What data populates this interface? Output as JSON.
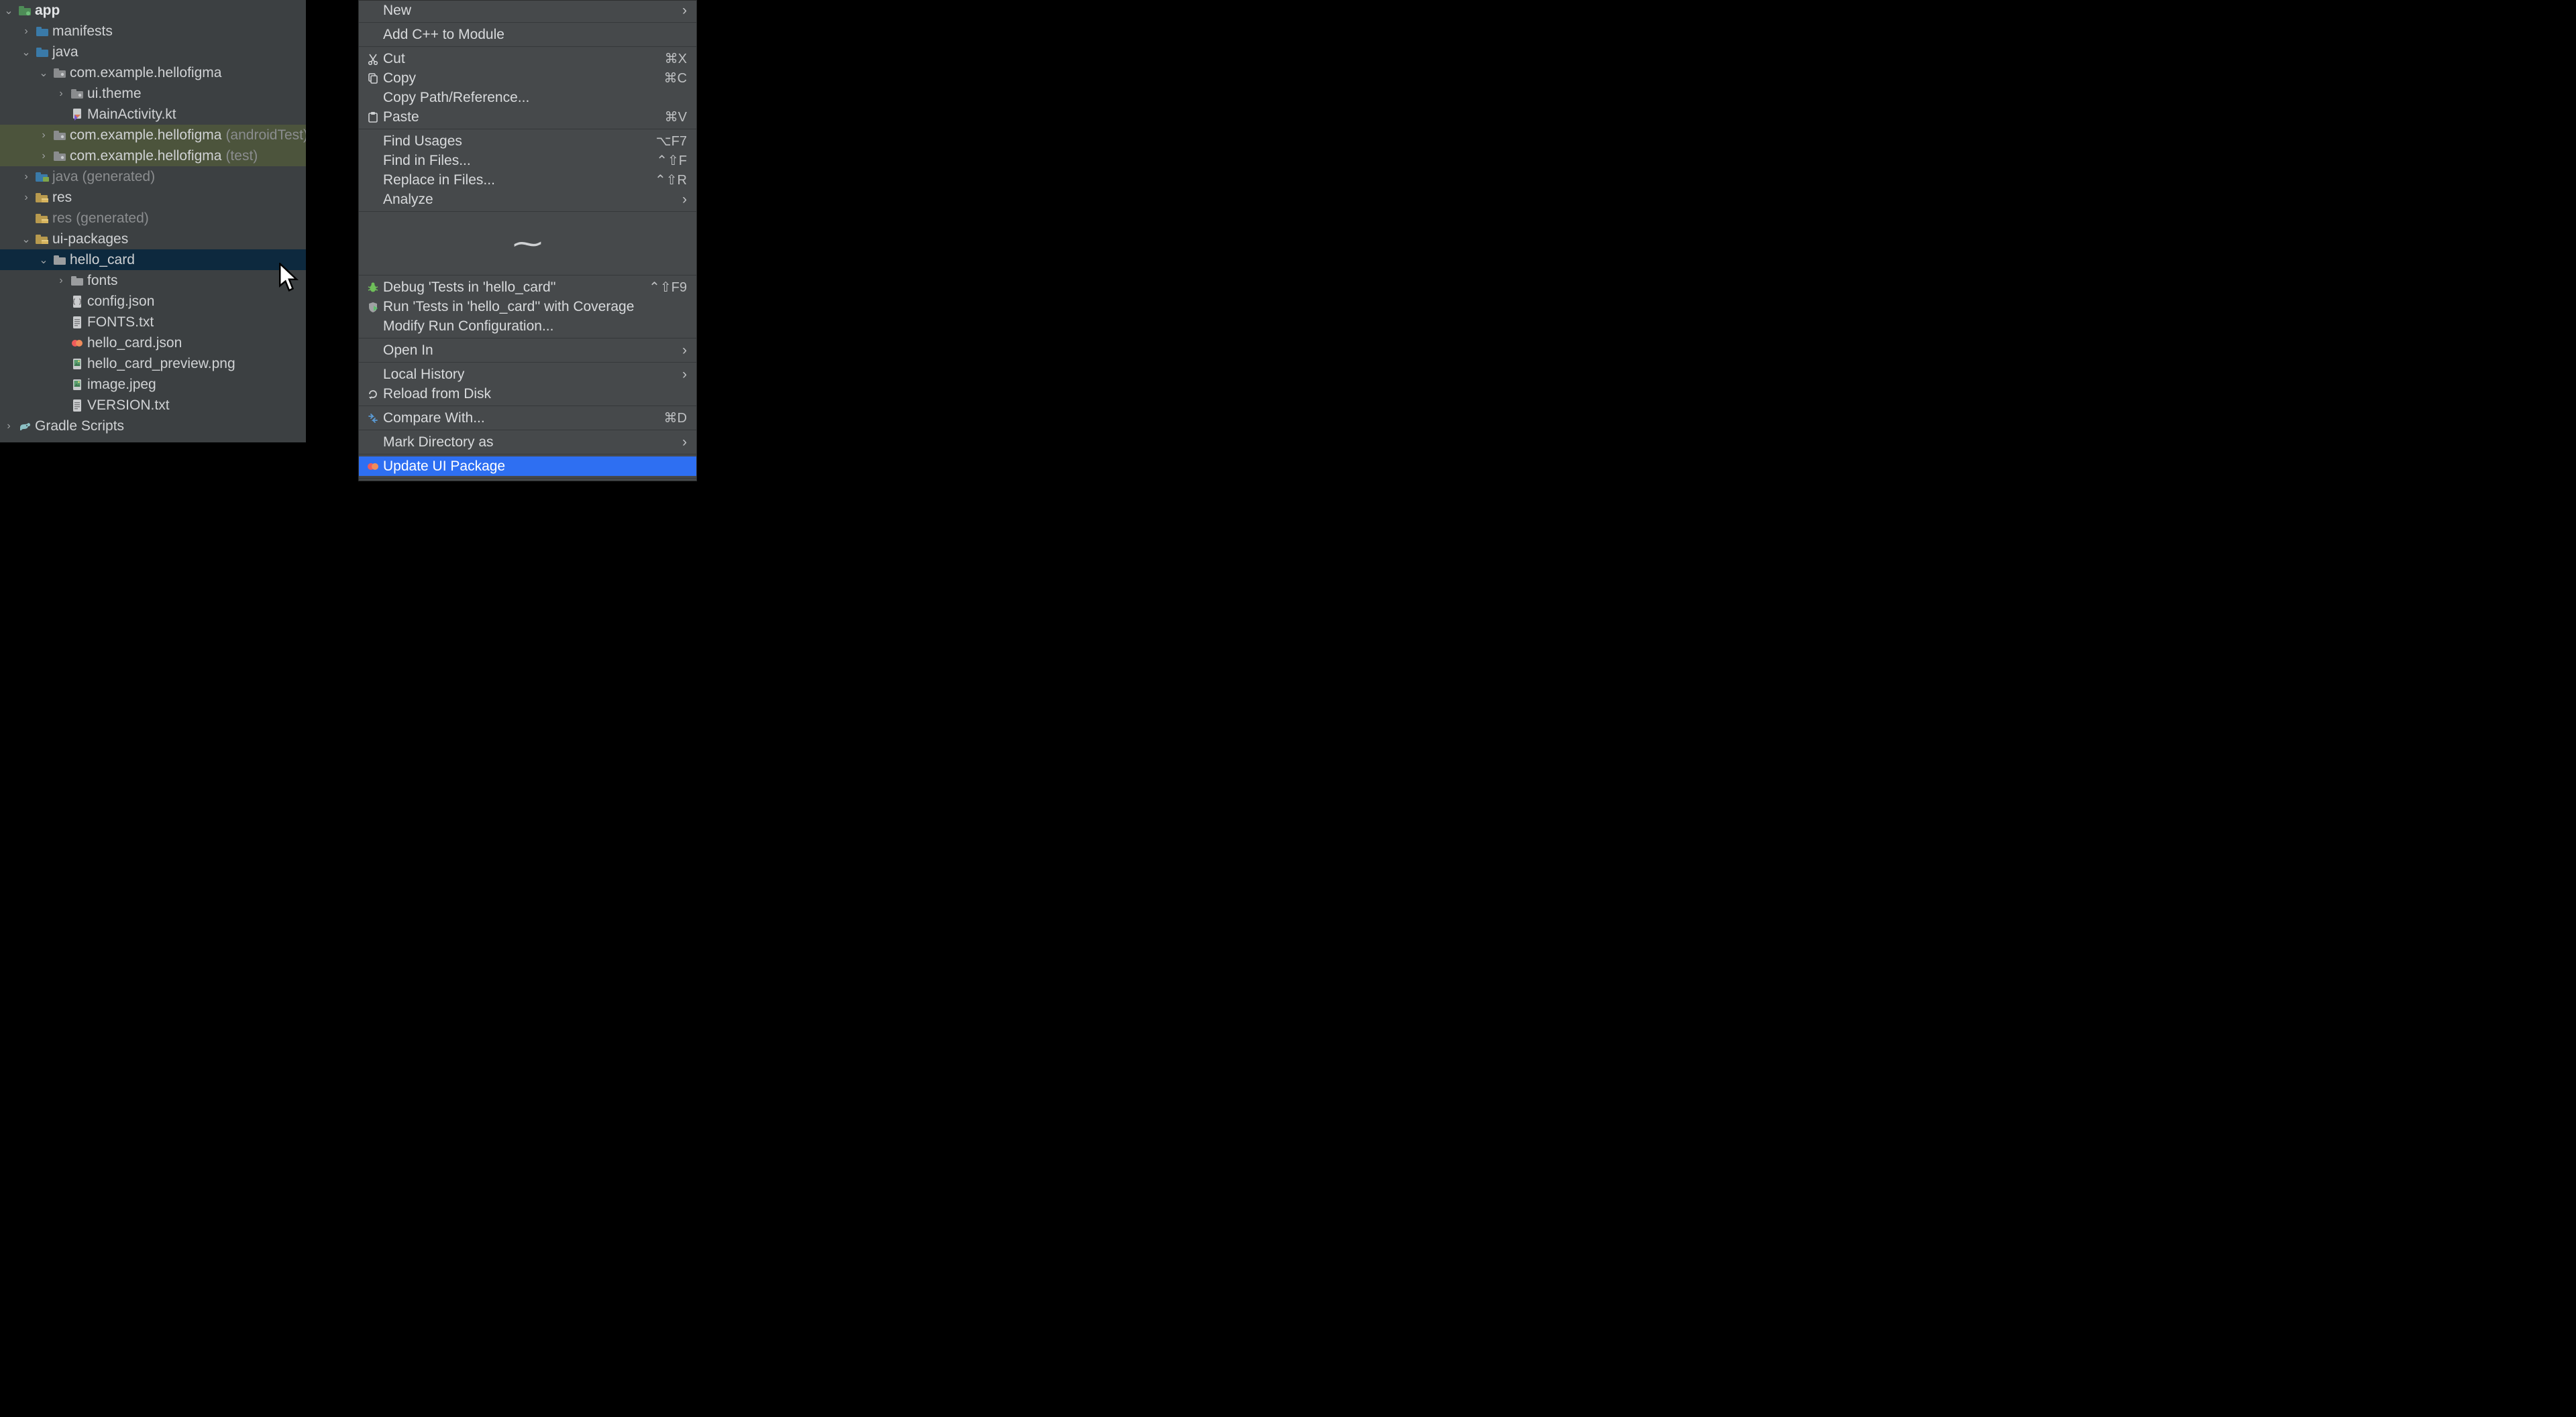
{
  "tree": {
    "rows": [
      {
        "depth": 0,
        "chev": "down",
        "icon": "module",
        "text": "app",
        "bold": true
      },
      {
        "depth": 1,
        "chev": "right",
        "icon": "folder",
        "text": "manifests"
      },
      {
        "depth": 1,
        "chev": "down",
        "icon": "folder",
        "text": "java"
      },
      {
        "depth": 2,
        "chev": "down",
        "icon": "package",
        "text": "com.example.hellofigma"
      },
      {
        "depth": 3,
        "chev": "right",
        "icon": "package",
        "text": "ui.theme"
      },
      {
        "depth": 3,
        "chev": "",
        "icon": "kotlin-file",
        "text": "MainActivity.kt"
      },
      {
        "depth": 2,
        "chev": "right",
        "icon": "package",
        "text": "com.example.hellofigma",
        "paren": "(androidTest)",
        "style": "olive"
      },
      {
        "depth": 2,
        "chev": "right",
        "icon": "package",
        "text": "com.example.hellofigma",
        "paren": "(test)",
        "style": "olive"
      },
      {
        "depth": 1,
        "chev": "right",
        "icon": "gen-folder",
        "text": "java",
        "paren": "(generated)",
        "fade": true
      },
      {
        "depth": 1,
        "chev": "right",
        "icon": "res-folder",
        "text": "res"
      },
      {
        "depth": 1,
        "chev": "",
        "icon": "res-folder",
        "text": "res",
        "paren": "(generated)",
        "fade": true
      },
      {
        "depth": 1,
        "chev": "down",
        "icon": "res-folder",
        "text": "ui-packages"
      },
      {
        "depth": 2,
        "chev": "down",
        "icon": "folder-gray",
        "text": "hello_card",
        "style": "selected"
      },
      {
        "depth": 3,
        "chev": "right",
        "icon": "folder-gray",
        "text": "fonts"
      },
      {
        "depth": 3,
        "chev": "",
        "icon": "json",
        "text": "config.json"
      },
      {
        "depth": 3,
        "chev": "",
        "icon": "text-file",
        "text": "FONTS.txt"
      },
      {
        "depth": 3,
        "chev": "",
        "icon": "figma",
        "text": "hello_card.json"
      },
      {
        "depth": 3,
        "chev": "",
        "icon": "image",
        "text": "hello_card_preview.png"
      },
      {
        "depth": 3,
        "chev": "",
        "icon": "image",
        "text": "image.jpeg"
      },
      {
        "depth": 3,
        "chev": "",
        "icon": "text-file",
        "text": "VERSION.txt"
      },
      {
        "depth": 0,
        "chev": "right",
        "icon": "gradle",
        "text": "Gradle Scripts"
      }
    ]
  },
  "menu": {
    "rows": [
      {
        "type": "item",
        "icon": "",
        "label": "New",
        "sub": true
      },
      {
        "type": "sep"
      },
      {
        "type": "item",
        "icon": "",
        "label": "Add C++ to Module"
      },
      {
        "type": "sep"
      },
      {
        "type": "item",
        "icon": "cut",
        "label": "Cut",
        "sc": "⌘X"
      },
      {
        "type": "item",
        "icon": "copy",
        "label": "Copy",
        "sc": "⌘C"
      },
      {
        "type": "item",
        "icon": "",
        "label": "Copy Path/Reference..."
      },
      {
        "type": "item",
        "icon": "paste",
        "label": "Paste",
        "sc": "⌘V"
      },
      {
        "type": "sep"
      },
      {
        "type": "item",
        "icon": "",
        "label": "Find Usages",
        "sc": "⌥F7"
      },
      {
        "type": "item",
        "icon": "",
        "label": "Find in Files...",
        "sc": "⌃⇧F"
      },
      {
        "type": "item",
        "icon": "",
        "label": "Replace in Files...",
        "sc": "⌃⇧R"
      },
      {
        "type": "item",
        "icon": "",
        "label": "Analyze",
        "sub": true
      },
      {
        "type": "sep"
      },
      {
        "type": "gap"
      },
      {
        "type": "sep"
      },
      {
        "type": "item",
        "icon": "bug",
        "label": "Debug 'Tests in 'hello_card''",
        "sc": "⌃⇧F9"
      },
      {
        "type": "item",
        "icon": "coverage",
        "label": "Run 'Tests in 'hello_card'' with Coverage"
      },
      {
        "type": "item",
        "icon": "",
        "label": "Modify Run Configuration..."
      },
      {
        "type": "sep"
      },
      {
        "type": "item",
        "icon": "",
        "label": "Open In",
        "sub": true
      },
      {
        "type": "sep"
      },
      {
        "type": "item",
        "icon": "",
        "label": "Local History",
        "sub": true
      },
      {
        "type": "item",
        "icon": "reload",
        "label": "Reload from Disk"
      },
      {
        "type": "sep"
      },
      {
        "type": "item",
        "icon": "compare",
        "label": "Compare With...",
        "sc": "⌘D"
      },
      {
        "type": "sep"
      },
      {
        "type": "item",
        "icon": "",
        "label": "Mark Directory as",
        "sub": true
      },
      {
        "type": "sep"
      },
      {
        "type": "item",
        "icon": "figma",
        "label": "Update UI Package",
        "hl": true
      },
      {
        "type": "sep"
      }
    ]
  }
}
